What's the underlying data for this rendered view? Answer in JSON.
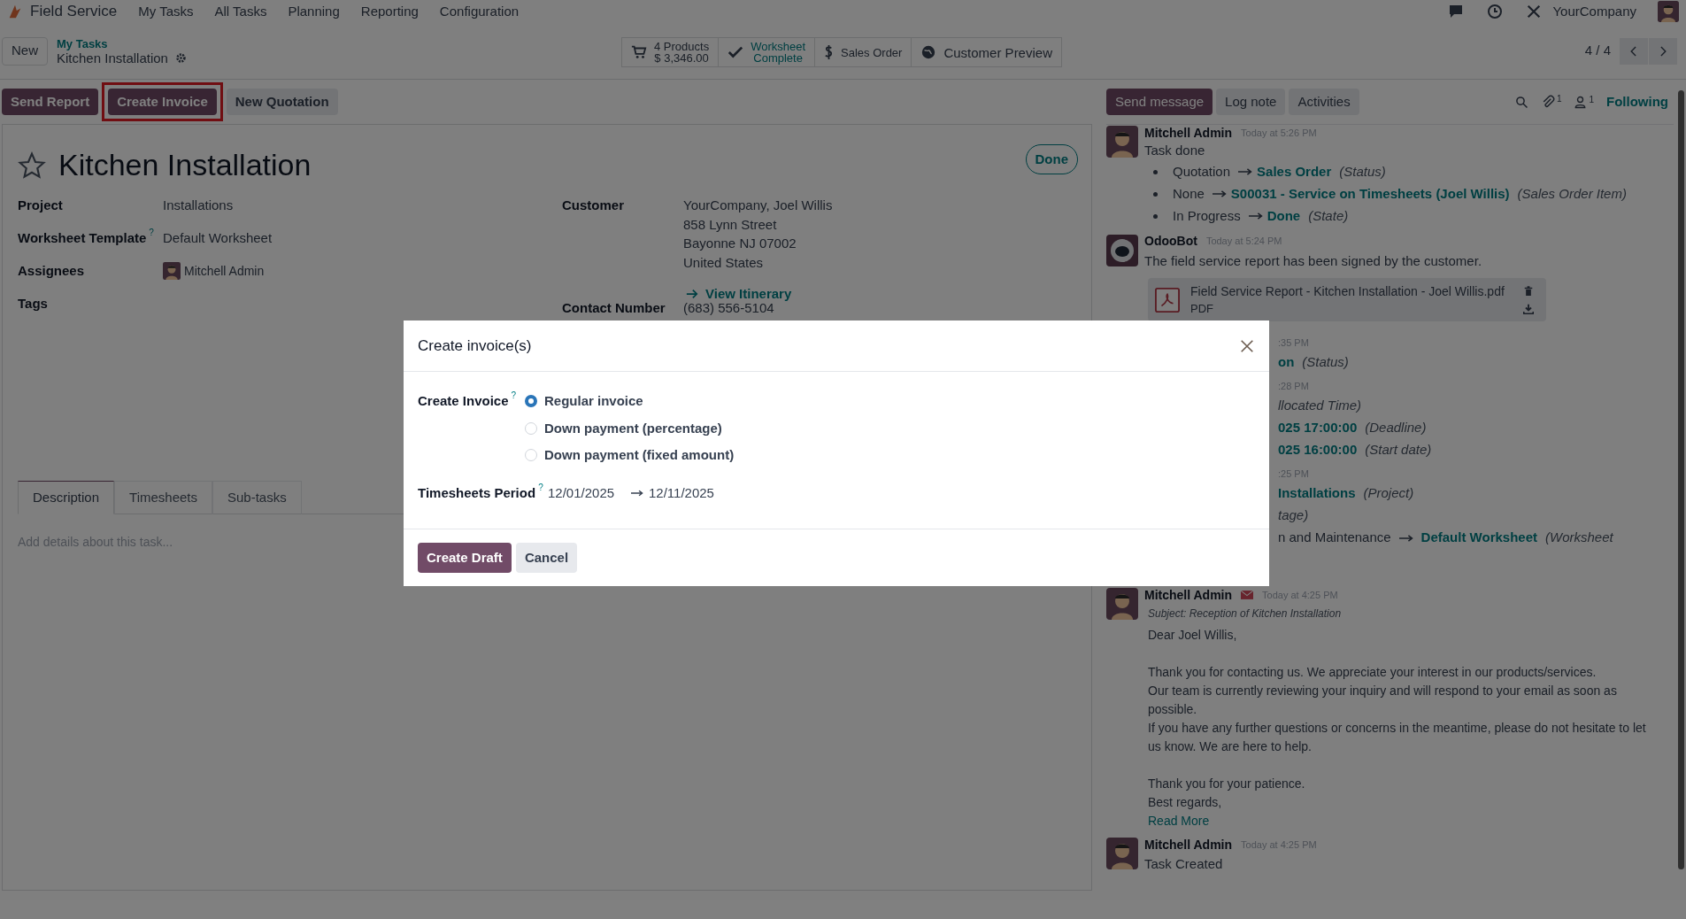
{
  "navbar": {
    "app_name": "Field Service",
    "menus": [
      "My Tasks",
      "All Tasks",
      "Planning",
      "Reporting",
      "Configuration"
    ],
    "company": "YourCompany"
  },
  "breadcrumb": {
    "new_button": "New",
    "parent": "My Tasks",
    "current": "Kitchen Installation"
  },
  "smart_buttons": [
    {
      "kind": "products",
      "line1": "4 Products",
      "line2": "$ 3,346.00"
    },
    {
      "kind": "worksheet",
      "line1": "Worksheet",
      "line2": "Complete"
    },
    {
      "kind": "sales",
      "line1": "Sales Order"
    },
    {
      "kind": "preview",
      "line1": "Customer Preview"
    }
  ],
  "pager": "4 / 4",
  "actions": [
    {
      "label": "Send Report",
      "kind": "primary",
      "highlighted": false
    },
    {
      "label": "Create Invoice",
      "kind": "primary",
      "highlighted": true
    },
    {
      "label": "New Quotation",
      "kind": "secondary",
      "highlighted": false
    }
  ],
  "chatter_actions": [
    {
      "label": "Send message",
      "kind": "primary"
    },
    {
      "label": "Log note",
      "kind": "secondary"
    },
    {
      "label": "Activities",
      "kind": "secondary"
    }
  ],
  "chatter_toolbar": {
    "attachments": "1",
    "followers": "1",
    "follow_label": "Following"
  },
  "task": {
    "title": "Kitchen Installation",
    "starred": false,
    "state": "Done",
    "fields": [
      {
        "label": "Project",
        "kind": "text",
        "value": "Installations"
      },
      {
        "label": "Worksheet Template",
        "help": "?",
        "kind": "text",
        "value": "Default Worksheet"
      },
      {
        "label": "Assignees",
        "kind": "user",
        "value": "Mitchell Admin"
      },
      {
        "label": "Tags",
        "kind": "empty"
      }
    ],
    "customer": {
      "label": "Customer",
      "lines": [
        "YourCompany, Joel Willis",
        "858 Lynn Street",
        "Bayonne NJ 07002",
        "United States"
      ],
      "link": "View Itinerary"
    },
    "contact": {
      "label": "Contact Number",
      "value": "(683) 556-5104"
    },
    "tabs": [
      {
        "label": "Description",
        "selected": true
      },
      {
        "label": "Timesheets",
        "selected": false
      },
      {
        "label": "Sub-tasks",
        "selected": false
      }
    ],
    "description_placeholder": "Add details about this task..."
  },
  "messages": [
    {
      "kind": "changes",
      "avatar": {
        "kind": "user"
      },
      "author": "Mitchell Admin",
      "time": "Today at 5:26 PM",
      "body": "Task done",
      "changes": [
        {
          "old": "Quotation",
          "new": "Sales Order",
          "field": "(Status)"
        },
        {
          "old": "None",
          "new": "S00031 - Service on Timesheets (Joel Willis)",
          "field": "(Sales Order Item)"
        },
        {
          "old": "In Progress",
          "new": "Done",
          "field": "(State)"
        }
      ]
    },
    {
      "kind": "attachment",
      "avatar": {
        "kind": "bot"
      },
      "author": "OdooBot",
      "time": "Today at 5:24 PM",
      "body": "The field service report has been signed by the customer.",
      "attachment": {
        "name": "Field Service Report - Kitchen Installation - Joel Willis.pdf",
        "type": "PDF"
      }
    },
    {
      "kind": "partial",
      "lines": [
        [
          {
            "kind": "time",
            "text": ":35 PM"
          }
        ],
        [
          {
            "kind": "link",
            "text": "on"
          },
          {
            "kind": "field",
            "text": "(Status)"
          }
        ],
        [
          {
            "kind": "time",
            "text": ":28 PM"
          }
        ],
        [
          {
            "kind": "field",
            "text": "llocated Time)"
          }
        ],
        [
          {
            "kind": "link",
            "text": "025 17:00:00"
          },
          {
            "kind": "field",
            "text": "(Deadline)"
          }
        ],
        [
          {
            "kind": "link",
            "text": "025 16:00:00"
          },
          {
            "kind": "field",
            "text": "(Start date)"
          }
        ],
        [
          {
            "kind": "time",
            "text": ":25 PM"
          }
        ],
        [
          {
            "kind": "link",
            "text": "Installations"
          },
          {
            "kind": "field",
            "text": "(Project)"
          }
        ],
        [
          {
            "kind": "field",
            "text": "tage)"
          }
        ],
        [
          {
            "kind": "plain",
            "text": "n and Maintenance"
          },
          {
            "kind": "arrow"
          },
          {
            "kind": "link",
            "text": "Default Worksheet"
          },
          {
            "kind": "field",
            "text": "(Worksheet"
          }
        ]
      ]
    },
    {
      "kind": "email",
      "avatar": {
        "kind": "user"
      },
      "author": "Mitchell Admin",
      "time": "Today at 4:25 PM",
      "subject": "Subject: Reception of Kitchen Installation",
      "blocks": [
        [
          "Dear Joel Willis,"
        ],
        [
          "Thank you for contacting us. We appreciate your interest in our products/services.",
          "Our team is currently reviewing your inquiry and will respond to your email as soon as possible.",
          "If you have any further questions or concerns in the meantime, please do not hesitate to let us know. We are here to help."
        ],
        [
          "Thank you for your patience.",
          "Best regards,"
        ]
      ],
      "read_more": "Read More"
    },
    {
      "kind": "plain",
      "avatar": {
        "kind": "user"
      },
      "author": "Mitchell Admin",
      "time": "Today at 4:25 PM",
      "body": "Task Created"
    }
  ],
  "dialog": {
    "title": "Create invoice(s)",
    "field_label": "Create Invoice",
    "field_help": "?",
    "options": [
      {
        "label": "Regular invoice",
        "selected": true
      },
      {
        "label": "Down payment (percentage)",
        "selected": false
      },
      {
        "label": "Down payment (fixed amount)",
        "selected": false
      }
    ],
    "period_label": "Timesheets Period",
    "period_help": "?",
    "period_start": "12/01/2025",
    "period_end": "12/11/2025",
    "buttons": [
      {
        "label": "Create Draft",
        "kind": "primary"
      },
      {
        "label": "Cancel",
        "kind": "secondary"
      }
    ]
  }
}
